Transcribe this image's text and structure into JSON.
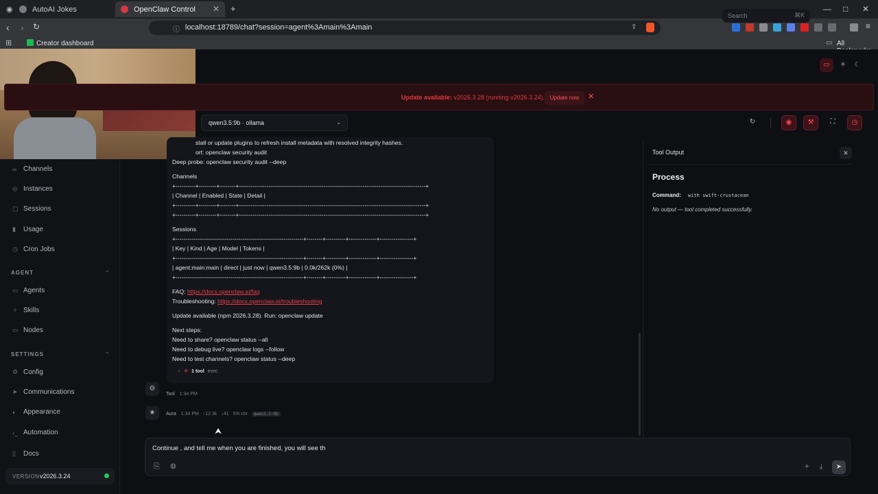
{
  "browser": {
    "tabs": [
      {
        "label": "AutoAI Jokes"
      },
      {
        "label": "OpenClaw Control"
      }
    ],
    "url": "localhost:18789/chat?session=agent%3Amain%3Amain",
    "bookmark": "Creator dashboard",
    "all_bookmarks": "All Bookmarks"
  },
  "sidebar": {
    "items_top": [
      {
        "label": "Channels",
        "icon": "link-icon"
      },
      {
        "label": "Instances",
        "icon": "broadcast-icon"
      },
      {
        "label": "Sessions",
        "icon": "file-icon"
      },
      {
        "label": "Usage",
        "icon": "bar-chart-icon"
      },
      {
        "label": "Cron Jobs",
        "icon": "clock-icon"
      }
    ],
    "agent_section": "AGENT",
    "agent_items": [
      {
        "label": "Agents"
      },
      {
        "label": "Skills"
      },
      {
        "label": "Nodes"
      }
    ],
    "settings_section": "SETTINGS",
    "settings_items": [
      {
        "label": "Config"
      },
      {
        "label": "Communications"
      },
      {
        "label": "Appearance"
      },
      {
        "label": "Automation"
      }
    ],
    "docs": "Docs",
    "version_label": "VERSION",
    "version_value": "v2026.3.24",
    "status_color": "#22c55e"
  },
  "header": {
    "search_placeholder": "Search",
    "search_shortcut": "⌘K"
  },
  "banner": {
    "title": "Update available:",
    "detail": "v2026.3.28 (running v2026.3.24).",
    "button": "Update now",
    "color": "#e0393f"
  },
  "model_select": "qwen3.5:9b · ollama",
  "message": {
    "lines": [
      "stall or update plugins to refresh install metadata with resolved integrity hashes.",
      "ort: openclaw security audit",
      "Deep probe: openclaw security audit --deep",
      "Channels",
      "+----------+---------+--------+-----------------------------------------------------------------------------------------------+",
      "| Channel | Enabled | State | Detail |",
      "+----------+---------+--------+-----------------------------------------------------------------------------------------------+",
      "+----------+---------+--------+-----------------------------------------------------------------------------------------------+",
      "Sessions",
      "+-----------------------------------------------------------------+--------+----------+--------------+-----------------+",
      "| Key | Kind | Age | Model | Tokens |",
      "+-----------------------------------------------------------------+--------+----------+--------------+-----------------+",
      "| agent:main:main | direct | just now | qwen3.5:9b | 0.0k/262k (0%) |",
      "+-----------------------------------------------------------------+--------+----------+--------------+-----------------+"
    ],
    "faq_label": "FAQ:",
    "faq_link": "https://docs.openclaw.ai/faq",
    "trouble_label": "Troubleshooting:",
    "trouble_link": "https://docs.openclaw.ai/troubleshooting",
    "update_line": "Update available (npm 2026.3.28). Run: openclaw update",
    "next_steps": [
      "Next steps:",
      "Need to share? openclaw status --all",
      "Need to debug live? openclaw logs --follow",
      "Need to test channels? openclaw status --deep"
    ],
    "tool_count": "1 tool",
    "tool_name": "exec"
  },
  "tool_meta": {
    "name": "Tool",
    "time": "1:34 PM"
  },
  "aura_meta": {
    "name": "Aura",
    "time": "1:34 PM",
    "tokens_in": "↑12.3k",
    "tokens_out": "↓41",
    "ctx": "5% ctx",
    "model": "qwen3.5:9b"
  },
  "tool_output": {
    "header": "Tool Output",
    "title": "Process",
    "command_label": "Command:",
    "command_value": "with swift-crustacean",
    "result": "No output — tool completed successfully."
  },
  "composer": {
    "value": "Continue , and tell me when you are finished, you will  see th"
  }
}
